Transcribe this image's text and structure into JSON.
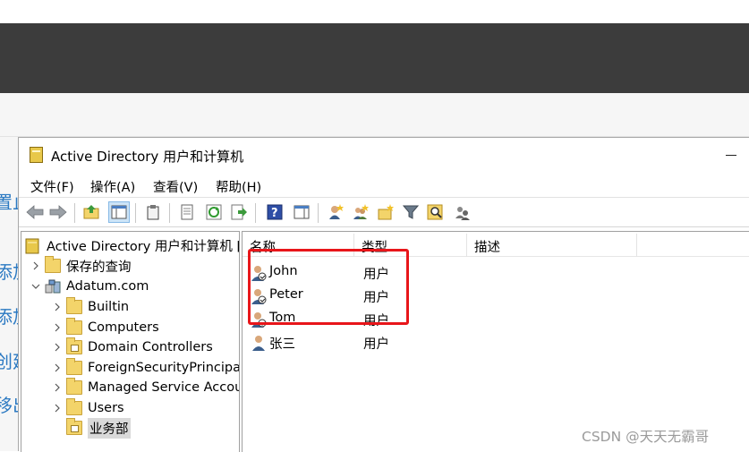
{
  "background": {
    "fragments": [
      "置止",
      "添加",
      "添加",
      "创建",
      "移出"
    ]
  },
  "window": {
    "title": "Active Directory 用户和计算机",
    "menu": [
      "文件(F)",
      "操作(A)",
      "查看(V)",
      "帮助(H)"
    ]
  },
  "toolbar": {
    "icons": [
      "back-arrow-icon",
      "forward-arrow-icon",
      "up-folder-icon",
      "show-hide-tree-icon",
      "clipboard-icon",
      "properties-icon",
      "refresh-icon",
      "export-list-icon",
      "help-icon",
      "action-pane-icon",
      "new-user-icon",
      "new-group-icon",
      "new-ou-icon",
      "filter-icon",
      "find-icon",
      "delegate-icon"
    ]
  },
  "tree": {
    "root": "Active Directory 用户和计算机 [",
    "saved_queries": "保存的查询",
    "domain": "Adatum.com",
    "children": [
      "Builtin",
      "Computers",
      "Domain Controllers",
      "ForeignSecurityPrincipal",
      "Managed Service Accou",
      "Users",
      "业务部"
    ]
  },
  "list": {
    "columns": [
      "名称",
      "类型",
      "描述"
    ],
    "rows": [
      {
        "name": "John",
        "type": "用户",
        "desc": ""
      },
      {
        "name": "Peter",
        "type": "用户",
        "desc": ""
      },
      {
        "name": "Tom",
        "type": "用户",
        "desc": ""
      },
      {
        "name": "张三",
        "type": "用户",
        "desc": ""
      }
    ]
  },
  "colors": {
    "highlight": "#e8161a",
    "top_bar": "#3c3c3c",
    "background_link": "#2b79c2"
  },
  "watermark": "CSDN @天天无霸哥"
}
